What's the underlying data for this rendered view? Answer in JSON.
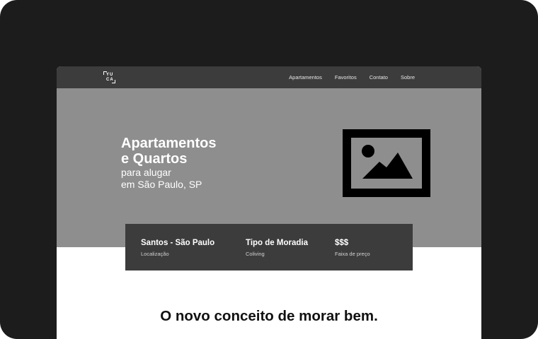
{
  "logo": {
    "line1": "YU",
    "line2": "CA"
  },
  "nav": {
    "items": [
      {
        "label": "Apartamentos"
      },
      {
        "label": "Favoritos"
      },
      {
        "label": "Contato"
      },
      {
        "label": "Sobre"
      }
    ]
  },
  "hero": {
    "title_line1": "Apartamentos",
    "title_line2": "e Quartos",
    "subtitle_line1": "para alugar",
    "subtitle_line2": "em São Paulo, SP",
    "image_icon": "image-placeholder-icon"
  },
  "info": [
    {
      "value": "Santos - São Paulo",
      "label": "Localização"
    },
    {
      "value": "Tipo de Moradia",
      "label": "Coliving"
    },
    {
      "value": "$$$",
      "label": "Faixa de preço"
    }
  ],
  "tagline": "O novo conceito de morar bem.",
  "colors": {
    "frame": "#1c1c1c",
    "navbar": "#3c3c3c",
    "hero": "#8e8e8e",
    "info_box": "#3c3c3c",
    "page": "#ffffff"
  }
}
